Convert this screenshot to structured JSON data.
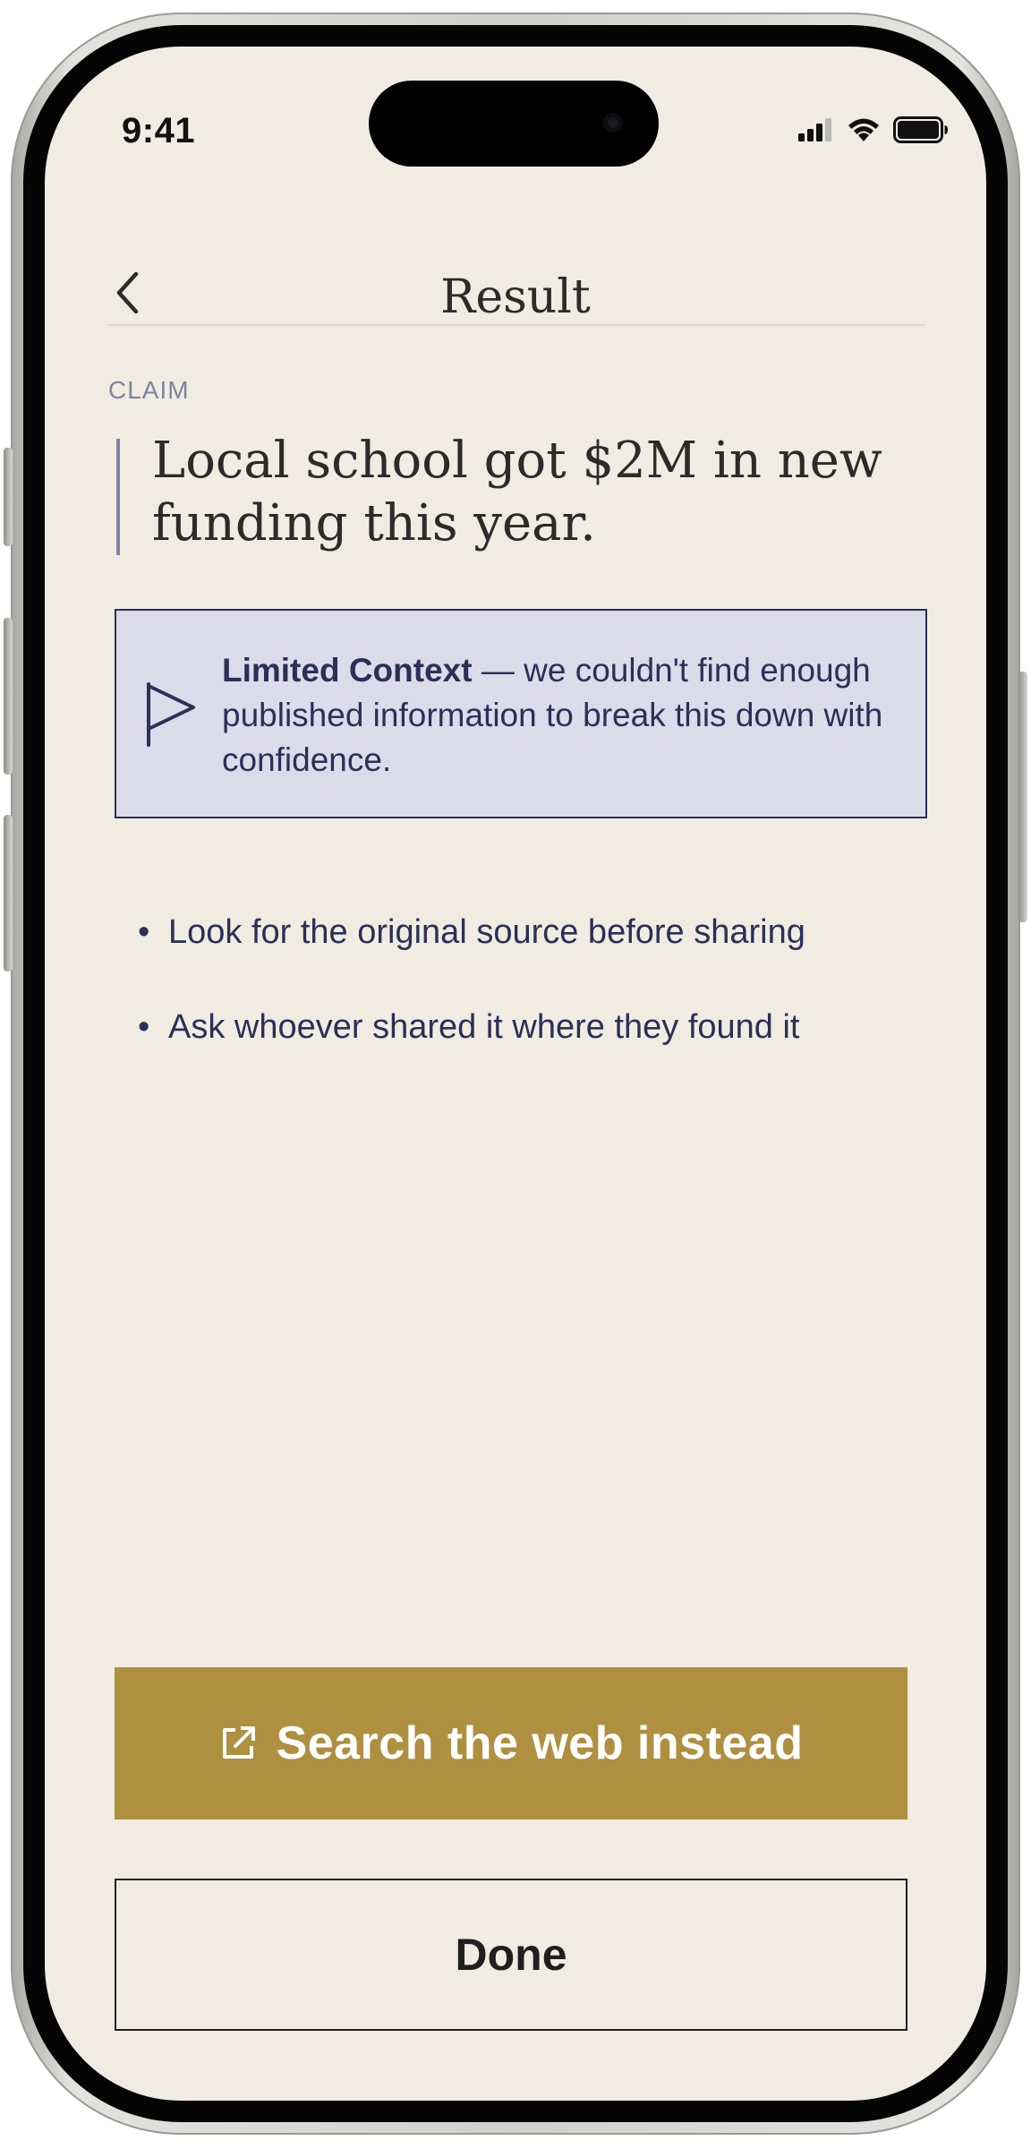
{
  "status_bar": {
    "time": "9:41",
    "icons": [
      "cellular-signal-icon",
      "wifi-icon",
      "battery-icon"
    ]
  },
  "nav": {
    "back_icon": "chevron-left-icon",
    "title": "Result"
  },
  "claim": {
    "label": "CLAIM",
    "text": "Local school got $2M in new funding this year."
  },
  "context": {
    "icon": "flag-icon",
    "strong": "Limited Context",
    "rest": " — we couldn't find enough published information to break this down with confidence."
  },
  "tips": [
    {
      "bullet": "•",
      "text": "Look for the original source before sharing"
    },
    {
      "bullet": "•",
      "text": "Ask whoever shared it where they found it"
    }
  ],
  "actions": {
    "search_icon": "external-link-icon",
    "search_label": "Search the web instead",
    "done_label": "Done"
  },
  "colors": {
    "background": "#f0ece2",
    "accent_gold": "#af8f40",
    "navy": "#2b3057",
    "context_bg": "#dcdbea",
    "muted_label": "#7e83a3"
  }
}
